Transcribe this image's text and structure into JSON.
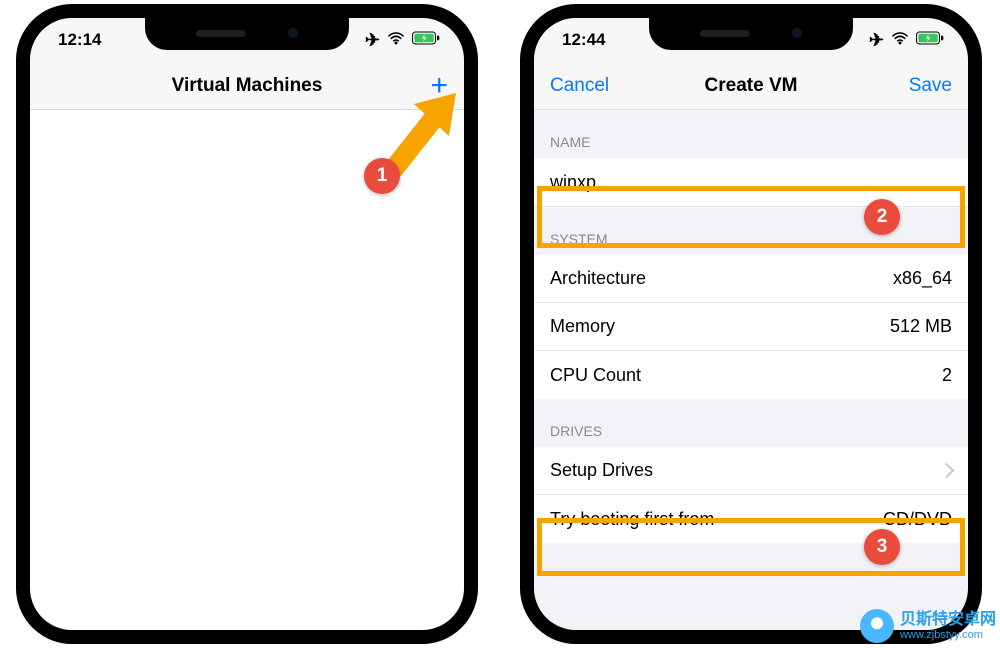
{
  "left": {
    "status": {
      "time": "12:14"
    },
    "nav": {
      "title": "Virtual Machines"
    }
  },
  "right": {
    "status": {
      "time": "12:44"
    },
    "nav": {
      "cancel": "Cancel",
      "title": "Create VM",
      "save": "Save"
    },
    "sections": {
      "name_header": "NAME",
      "name_value": "winxp",
      "system_header": "SYSTEM",
      "architecture": {
        "label": "Architecture",
        "value": "x86_64"
      },
      "memory": {
        "label": "Memory",
        "value": "512  MB"
      },
      "cpu": {
        "label": "CPU Count",
        "value": "2"
      },
      "drives_header": "DRIVES",
      "setup_drives": "Setup Drives",
      "boot_first": {
        "label": "Try booting first from",
        "value": "CD/DVD"
      }
    }
  },
  "markers": {
    "m1": "1",
    "m2": "2",
    "m3": "3"
  },
  "watermark": {
    "title": "贝斯特安卓网",
    "url": "www.zjbstyy.com"
  }
}
